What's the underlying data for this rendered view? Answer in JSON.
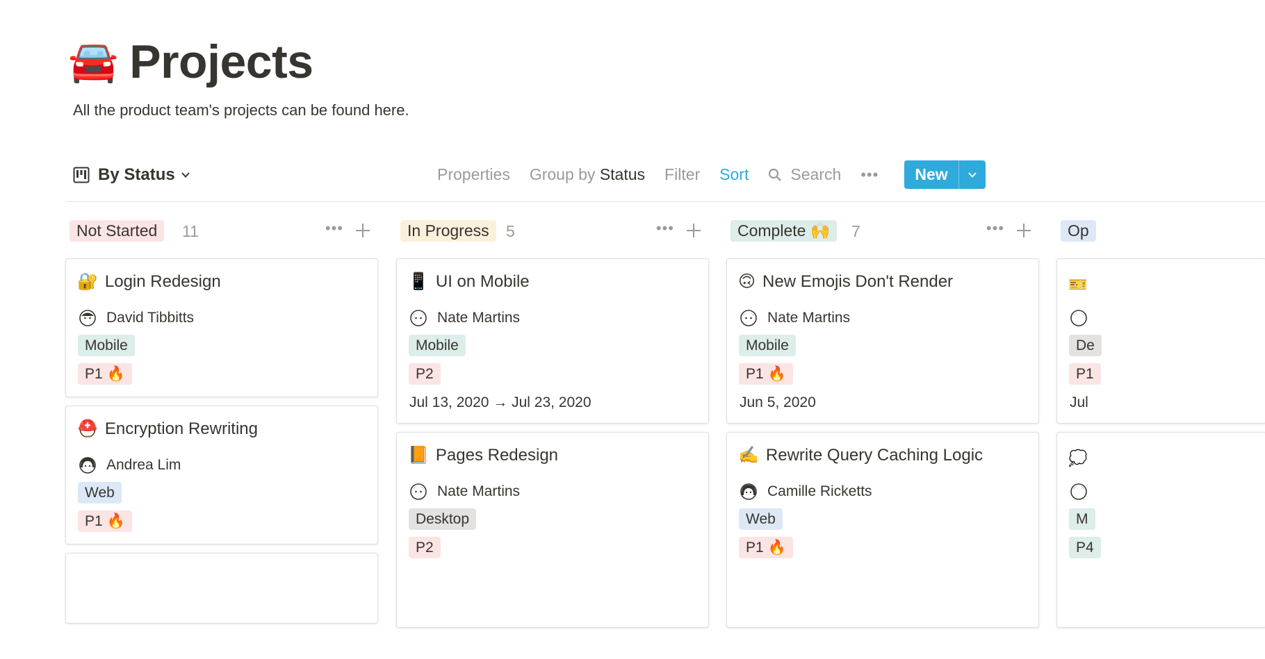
{
  "page": {
    "emoji": "🚘",
    "title": "Projects",
    "description": "All the product team's projects can be found here."
  },
  "toolbar": {
    "view_label": "By Status",
    "properties": "Properties",
    "group_by_prefix": "Group by",
    "group_by_value": "Status",
    "filter": "Filter",
    "sort": "Sort",
    "search": "Search",
    "more": "•••",
    "new_label": "New"
  },
  "colors": {
    "accent": "#2eaadc",
    "not_started": "#fbe4e4",
    "in_progress": "#fbf0dc",
    "complete": "#ddede9",
    "open_partial": "#dde8f6",
    "tag_mobile": "#ddede9",
    "tag_web": "#dde8f6",
    "tag_desktop": "#e3e2e0",
    "tag_priority": "#fbe4e4"
  },
  "columns": [
    {
      "name": "Not Started",
      "count": "11",
      "color": "#fbe4e4",
      "cards": [
        {
          "icon": "🔐",
          "title": "Login Redesign",
          "person": "David Tibbitts",
          "tag": "Mobile",
          "priority": "P1 🔥",
          "date": ""
        },
        {
          "icon": "⛑️",
          "title": "Encryption Rewriting",
          "person": "Andrea Lim",
          "tag": "Web",
          "priority": "P1 🔥",
          "date": ""
        }
      ]
    },
    {
      "name": "In Progress",
      "count": "5",
      "color": "#fbf0dc",
      "cards": [
        {
          "icon": "📱",
          "title": "UI on Mobile",
          "person": "Nate Martins",
          "tag": "Mobile",
          "priority": "P2",
          "date": "Jul 13, 2020 → Jul 23, 2020"
        },
        {
          "icon": "📙",
          "title": "Pages Redesign",
          "person": "Nate Martins",
          "tag": "Desktop",
          "priority": "P2",
          "date": ""
        }
      ]
    },
    {
      "name": "Complete 🙌",
      "count": "7",
      "color": "#ddede9",
      "cards": [
        {
          "icon": "🙃",
          "title": "New Emojis Don't Render",
          "person": "Nate Martins",
          "tag": "Mobile",
          "priority": "P1 🔥",
          "date": "Jun 5, 2020"
        },
        {
          "icon": "✍️",
          "title": "Rewrite Query Caching Logic",
          "person": "Camille Ricketts",
          "tag": "Web",
          "priority": "P1 🔥",
          "date": ""
        }
      ]
    },
    {
      "name": "Op",
      "partial_tags": [
        "De",
        "P1",
        "Jul",
        "M",
        "P4"
      ]
    }
  ]
}
